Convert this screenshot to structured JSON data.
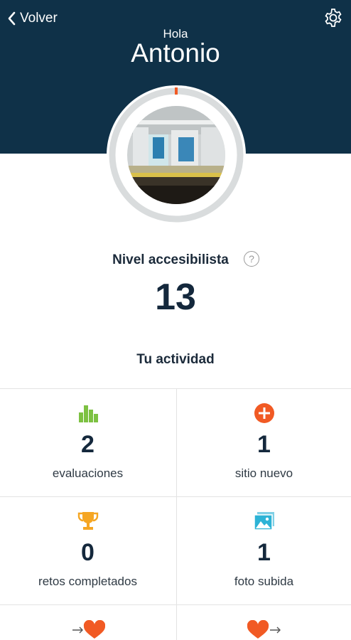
{
  "nav": {
    "back_label": "Volver",
    "back_icon": "chevron-left-icon",
    "settings_icon": "gear-icon"
  },
  "profile": {
    "greeting": "Hola",
    "name": "Antonio",
    "avatar": "profile-photo"
  },
  "level": {
    "title": "Nivel accesibilista",
    "value": "13",
    "help_symbol": "?",
    "progress": 0.01
  },
  "activity": {
    "title": "Tu actividad",
    "items": [
      {
        "icon": "bar-chart-icon",
        "count": "2",
        "label": "evaluaciones"
      },
      {
        "icon": "plus-circle-icon",
        "count": "1",
        "label": "sitio nuevo"
      },
      {
        "icon": "trophy-icon",
        "count": "0",
        "label": "retos completados"
      },
      {
        "icon": "photo-icon",
        "count": "1",
        "label": "foto subida"
      }
    ],
    "bottom": [
      {
        "icon": "heart-in-icon"
      },
      {
        "icon": "heart-out-icon"
      }
    ]
  },
  "colors": {
    "header": "#0f3148",
    "accent": "#f15a24",
    "green": "#7dc142",
    "trophy": "#f5a623",
    "photo": "#2db3d6"
  }
}
